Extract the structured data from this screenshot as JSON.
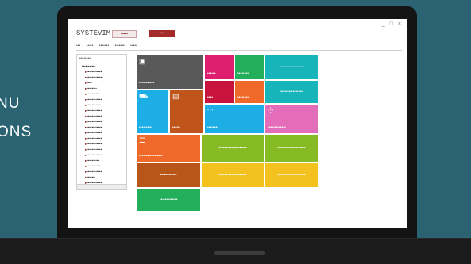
{
  "side_text": [
    "NU",
    "ONS"
  ],
  "app": {
    "logo": "SYSTEVIM",
    "window_controls": "_ □ ×",
    "top_button_1": "▪▪▪▪▪",
    "top_button_2": "▪▪▪▪"
  },
  "menubar": [
    "•••",
    "•••••",
    "•••••••",
    "•••••••",
    "•••••"
  ],
  "tree": {
    "header": "••••••••",
    "root": "•••••••••••",
    "items": [
      "••••••••••••",
      "•••••••••••••",
      "••••",
      "••••••••",
      "••••••••••",
      "••••••••••••",
      "•••••••••••",
      "••••••••••••",
      "••••••••••••",
      "••••••••••••",
      "••••••••••••",
      "••••••••••••",
      "••••••••••••",
      "••••••••••••",
      "••••••••••••",
      "••••••••••••",
      "••••••••••",
      "•••••••••••",
      "••••••••••••",
      "••••••",
      "••••••••••••"
    ]
  },
  "tiles": [
    {
      "label": "•••••••••••",
      "color": "#595959",
      "icon": "window-icon"
    },
    {
      "label": "••••••",
      "color": "#e01e6f"
    },
    {
      "label": "••••••••",
      "color": "#22ae5a"
    },
    {
      "label": "••••••••••••••••••",
      "color": "#17b4ba"
    },
    {
      "label": "••••",
      "color": "#c8143c"
    },
    {
      "label": "••••••••",
      "color": "#ef6a2a"
    },
    {
      "label": "••••••••••••••••",
      "color": "#17b4ba"
    },
    {
      "label": "•••••••••",
      "color": "#1eaee6",
      "icon": "truck-icon"
    },
    {
      "label": "•••••",
      "color": "#c0551c",
      "icon": "box-icon"
    },
    {
      "label": "••••••••",
      "color": "#1eaee6",
      "icon": "share-icon"
    },
    {
      "label": "•••••••••••••",
      "color": "#e36db8",
      "icon": "share-icon"
    },
    {
      "label": "•••••••••••••••••",
      "color": "#ef6a2a",
      "icon": "list-icon"
    },
    {
      "label": "••••••••••••••••••••",
      "color": "#86bb25"
    },
    {
      "label": "••••••••••••••••••••",
      "color": "#86bb25"
    },
    {
      "label": "••••••••••••",
      "color": "#b8561a"
    },
    {
      "label": "••••••••••••••••••••",
      "color": "#f4c21f"
    },
    {
      "label": "••••••••••••••••••••",
      "color": "#f4c21f"
    },
    {
      "label": "•••••••••••••",
      "color": "#22ae5a"
    }
  ]
}
